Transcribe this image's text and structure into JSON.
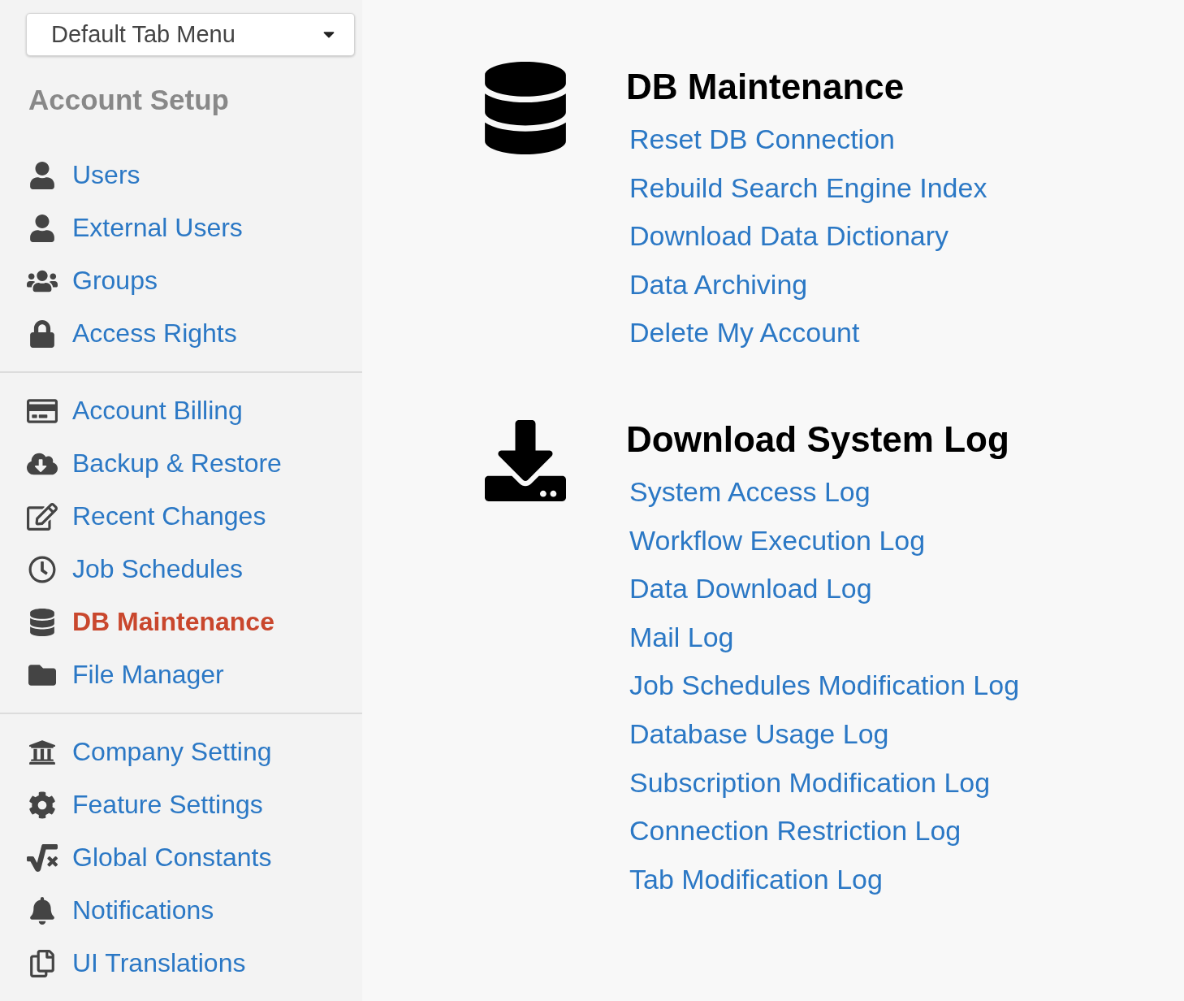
{
  "tab_menu": {
    "value": "Default Tab Menu"
  },
  "sidebar": {
    "title": "Account Setup",
    "groups": [
      {
        "items": [
          {
            "label": "Users",
            "selected": false
          },
          {
            "label": "External Users",
            "selected": false
          },
          {
            "label": "Groups",
            "selected": false
          },
          {
            "label": "Access Rights",
            "selected": false
          }
        ]
      },
      {
        "items": [
          {
            "label": "Account Billing",
            "selected": false
          },
          {
            "label": "Backup & Restore",
            "selected": false
          },
          {
            "label": "Recent Changes",
            "selected": false
          },
          {
            "label": "Job Schedules",
            "selected": false
          },
          {
            "label": "DB Maintenance",
            "selected": true
          },
          {
            "label": "File Manager",
            "selected": false
          }
        ]
      },
      {
        "items": [
          {
            "label": "Company Setting",
            "selected": false
          },
          {
            "label": "Feature Settings",
            "selected": false
          },
          {
            "label": "Global Constants",
            "selected": false
          },
          {
            "label": "Notifications",
            "selected": false
          },
          {
            "label": "UI Translations",
            "selected": false
          }
        ]
      }
    ]
  },
  "sections": [
    {
      "kind": "database",
      "title": "DB Maintenance",
      "links": [
        "Reset DB Connection",
        "Rebuild Search Engine Index",
        "Download Data Dictionary",
        "Data Archiving",
        "Delete My Account"
      ]
    },
    {
      "kind": "download",
      "title": "Download System Log",
      "links": [
        "System Access Log",
        "Workflow Execution Log",
        "Data Download Log",
        "Mail Log",
        "Job Schedules Modification Log",
        "Database Usage Log",
        "Subscription Modification Log",
        "Connection Restriction Log",
        "Tab Modification Log"
      ]
    }
  ]
}
